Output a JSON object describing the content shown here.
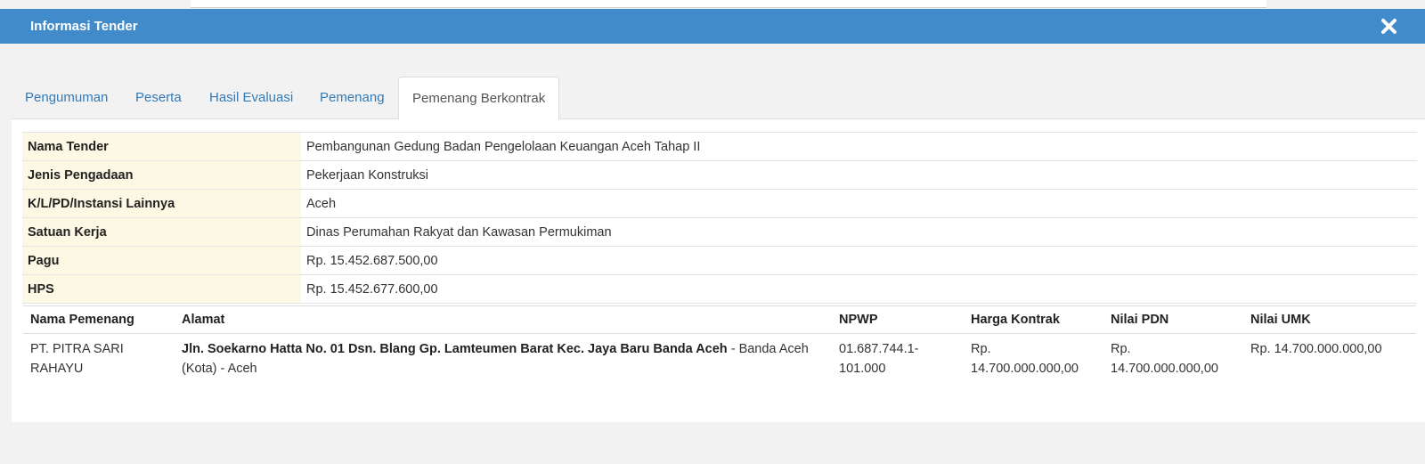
{
  "modal": {
    "title": "Informasi Tender"
  },
  "tabs": [
    {
      "label": "Pengumuman"
    },
    {
      "label": "Peserta"
    },
    {
      "label": "Hasil Evaluasi"
    },
    {
      "label": "Pemenang"
    },
    {
      "label": "Pemenang Berkontrak",
      "active": true
    }
  ],
  "info": [
    {
      "label": "Nama Tender",
      "value": "Pembangunan Gedung Badan Pengelolaan Keuangan Aceh Tahap II"
    },
    {
      "label": "Jenis Pengadaan",
      "value": "Pekerjaan Konstruksi"
    },
    {
      "label": "K/L/PD/Instansi Lainnya",
      "value": "Aceh"
    },
    {
      "label": "Satuan Kerja",
      "value": "Dinas Perumahan Rakyat dan Kawasan Permukiman"
    },
    {
      "label": "Pagu",
      "value": "Rp. 15.452.687.500,00"
    },
    {
      "label": "HPS",
      "value": "Rp. 15.452.677.600,00"
    }
  ],
  "winners": {
    "headers": {
      "nama": "Nama Pemenang",
      "alamat": "Alamat",
      "npwp": "NPWP",
      "harga": "Harga Kontrak",
      "pdn": "Nilai PDN",
      "umk": "Nilai UMK"
    },
    "rows": [
      {
        "nama": "PT. PITRA SARI RAHAYU",
        "alamat_street": "Jln. Soekarno Hatta No. 01 Dsn. Blang Gp. Lamteumen Barat Kec. Jaya Baru Banda Aceh",
        "alamat_sep": " - ",
        "alamat_region": "Banda Aceh (Kota) - Aceh",
        "npwp": "01.687.744.1-101.000",
        "harga": "Rp. 14.700.000.000,00",
        "pdn": "Rp. 14.700.000.000,00",
        "umk": "Rp. 14.700.000.000,00"
      }
    ]
  },
  "colors": {
    "header_bg": "#428bca",
    "label_bg": "#fcf8e3",
    "link": "#337ab7"
  }
}
